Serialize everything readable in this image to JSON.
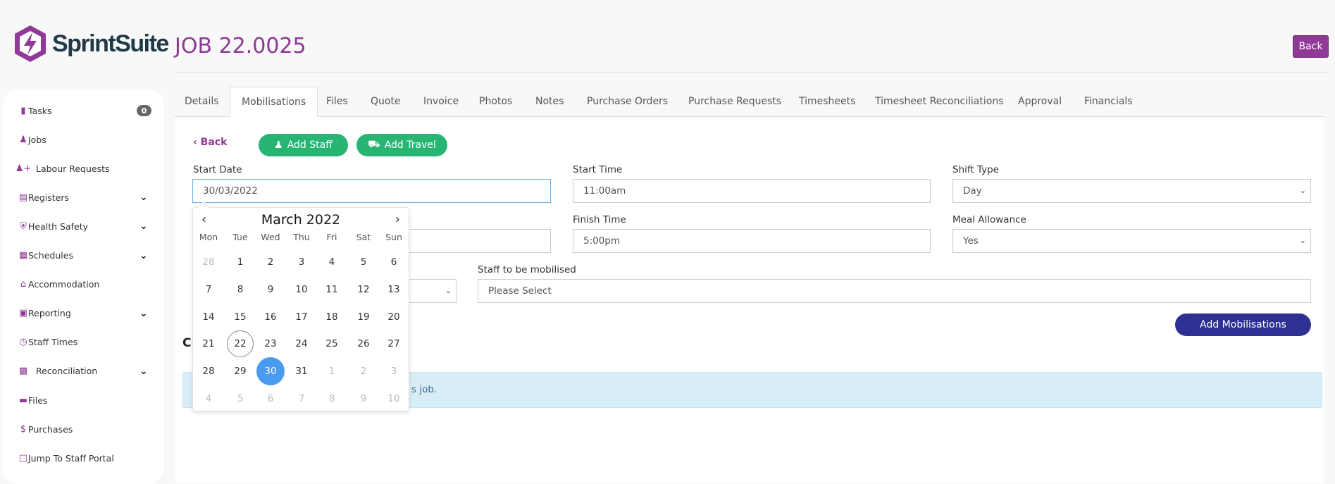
{
  "brand": {
    "name": "SprintSuite",
    "color": "#8e3a96"
  },
  "header": {
    "title": "JOB 22.0025",
    "back_label": "Back"
  },
  "sidebar": {
    "items": [
      {
        "label": "Tasks",
        "icon": "clipboard-icon",
        "badge": "0"
      },
      {
        "label": "Jobs",
        "icon": "worker-icon"
      },
      {
        "label": "Labour Requests",
        "icon": "user-plus-icon"
      },
      {
        "label": "Registers",
        "icon": "list-icon",
        "expandable": true
      },
      {
        "label": "Health Safety",
        "icon": "shield-heart-icon",
        "expandable": true
      },
      {
        "label": "Schedules",
        "icon": "calendar-icon",
        "expandable": true
      },
      {
        "label": "Accommodation",
        "icon": "home-icon"
      },
      {
        "label": "Reporting",
        "icon": "report-icon",
        "expandable": true
      },
      {
        "label": "Staff Times",
        "icon": "clock-icon"
      },
      {
        "label": "Reconciliation",
        "icon": "archive-icon",
        "expandable": true
      },
      {
        "label": "Files",
        "icon": "folder-icon"
      },
      {
        "label": "Purchases",
        "icon": "dollar-icon"
      },
      {
        "label": "Jump To Staff Portal",
        "icon": "portal-icon"
      }
    ]
  },
  "tabs": [
    {
      "label": "Details"
    },
    {
      "label": "Mobilisations",
      "active": true
    },
    {
      "label": "Files"
    },
    {
      "label": "Quote"
    },
    {
      "label": "Invoice"
    },
    {
      "label": "Photos"
    },
    {
      "label": "Notes"
    },
    {
      "label": "Purchase Orders"
    },
    {
      "label": "Purchase Requests"
    },
    {
      "label": "Timesheets"
    },
    {
      "label": "Timesheet Reconciliations"
    },
    {
      "label": "Approval"
    },
    {
      "label": "Financials"
    }
  ],
  "toolbar": {
    "back_label": "Back",
    "add_staff_label": "Add Staff",
    "add_travel_label": "Add Travel",
    "green": "#27b574"
  },
  "form": {
    "start_date": {
      "label": "Start Date",
      "value": "30/03/2022"
    },
    "start_time": {
      "label": "Start Time",
      "value": "11:00am"
    },
    "shift_type": {
      "label": "Shift Type",
      "value": "Day"
    },
    "finish_time": {
      "label": "Finish Time",
      "value": "5:00pm"
    },
    "meal_allowance": {
      "label": "Meal Allowance",
      "value": "Yes"
    },
    "staff": {
      "label": "Staff to be mobilised",
      "placeholder": "Please Select"
    },
    "submit_label": "Add Mobilisations",
    "submit_color": "#2e3192"
  },
  "section": {
    "heading_fragment": "Cu",
    "alert_fragment": "s job."
  },
  "calendar": {
    "month": "March",
    "year": "2022",
    "weekdays": [
      "Mon",
      "Tue",
      "Wed",
      "Thu",
      "Fri",
      "Sat",
      "Sun"
    ],
    "weeks": [
      [
        "28",
        "1",
        "2",
        "3",
        "4",
        "5",
        "6"
      ],
      [
        "7",
        "8",
        "9",
        "10",
        "11",
        "12",
        "13"
      ],
      [
        "14",
        "15",
        "16",
        "17",
        "18",
        "19",
        "20"
      ],
      [
        "21",
        "22",
        "23",
        "24",
        "25",
        "26",
        "27"
      ],
      [
        "28",
        "29",
        "30",
        "31",
        "1",
        "2",
        "3"
      ],
      [
        "4",
        "5",
        "6",
        "7",
        "8",
        "9",
        "10"
      ]
    ],
    "today": "22",
    "selected": "30",
    "selected_color": "#4a9af0"
  }
}
